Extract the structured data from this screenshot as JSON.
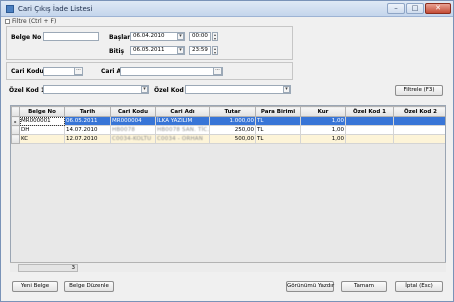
{
  "window": {
    "title": "Cari Çıkış İade Listesi",
    "controls": [
      "–",
      "□",
      "✕"
    ]
  },
  "filter": {
    "toggle_label": "Filtre (Ctrl + F)",
    "belge_no": {
      "label": "Belge No",
      "value": ""
    },
    "baslangic": {
      "label": "Başlangıç",
      "date": "06.04.2010",
      "time": "00:00"
    },
    "bitis": {
      "label": "Bitiş",
      "date": "06.05.2011",
      "time": "23:59"
    },
    "cari_kodu": {
      "label": "Cari Kodu",
      "value": ""
    },
    "cari_adi": {
      "label": "Cari Adı",
      "value": ""
    },
    "ozel_kod_1": {
      "label": "Özel Kod 1",
      "value": ""
    },
    "ozel_kod_2": {
      "label": "Özel Kod 2",
      "value": ""
    },
    "filter_button": "Filtrele (F3)"
  },
  "grid": {
    "columns": [
      "Belge No",
      "Tarih",
      "Cari Kodu",
      "Cari Adı",
      "Tutar",
      "Para Birimi",
      "Kur",
      "Özel Kod 1",
      "Özel Kod 2"
    ],
    "rows": [
      {
        "belge_no": "MR000001",
        "tarih": "06.05.2011",
        "cari_kodu": "MR000004",
        "cari_adi": "İLKA YAZILIM",
        "tutar": "1.000,00",
        "para_birimi": "TL",
        "kur": "1,00",
        "ozel1": "",
        "ozel2": ""
      },
      {
        "belge_no": "DH",
        "tarih": "14.07.2010",
        "cari_kodu": "HB0078",
        "cari_adi": "HB0078 SAN. TİC.",
        "tutar": "250,00",
        "para_birimi": "TL",
        "kur": "1,00",
        "ozel1": "",
        "ozel2": ""
      },
      {
        "belge_no": "KC",
        "tarih": "12.07.2010",
        "cari_kodu": "C0034-KOLTU",
        "cari_adi": "C0034 - ORHAN",
        "tutar": "500,00",
        "para_birimi": "TL",
        "kur": "1,00",
        "ozel1": "",
        "ozel2": ""
      }
    ],
    "row_count": "3"
  },
  "buttons": {
    "yeni_belge": "Yeni Belge",
    "belge_duzenle": "Belge Düzenle",
    "gorunumu_yazdir": "Görünümü Yazdır",
    "tamam": "Tamam",
    "iptal": "İptal (Esc)"
  }
}
